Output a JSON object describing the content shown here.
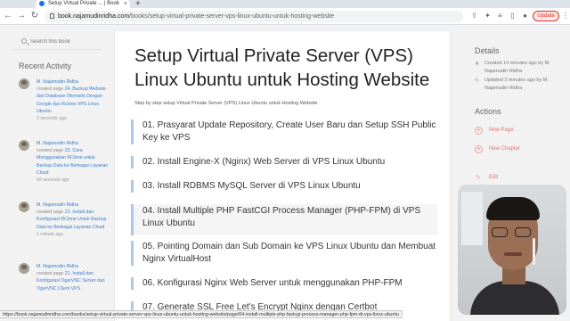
{
  "browser": {
    "tab_title": "Setup Virtual Private ... | Book",
    "new_tab_glyph": "+",
    "url_host": "book.najamudinridha.com",
    "url_path": "/books/setup-virtual-private-server-vps-linux-ubuntu-untuk-hosting-website",
    "update_label": "Update",
    "status_url": "https://book.najamudinridha.com/books/setup-virtual-private-server-vps-linux-ubuntu-untuk-hosting-website/page/04-install-multiple-php-fastcgi-process-manager-php-fpm-di-vps-linux-ubuntu"
  },
  "sidebar": {
    "search_placeholder": "Search this book",
    "recent_title": "Recent Activity",
    "activities": [
      {
        "user": "M. Najamudin Ridha",
        "action": "created page",
        "target": "24. Backup Website dan Database Otomatis Dengan Google dan Rclone VPS Linux Ubuntu",
        "time": "3 seconds ago"
      },
      {
        "user": "M. Najamudin Ridha",
        "action": "created page",
        "target": "23. Cara Menggunakan RClone untuk Backup Data ke Berbagai Layanan Cloud",
        "time": "42 seconds ago"
      },
      {
        "user": "M. Najamudin Ridha",
        "action": "created page",
        "target": "22. Install dan Konfigurasi RClone Untuk Backup Data ke Berbagai Layanan Cloud",
        "time": "1 minute ago"
      },
      {
        "user": "M. Najamudin Ridha",
        "action": "created page",
        "target": "21. Install dan Konfigurasi TigerVNC Server dan TigerVNC Client VPS",
        "time": ""
      }
    ]
  },
  "book": {
    "title": "Setup Virtual Private Server (VPS) Linux Ubuntu untuk Hosting Website",
    "description": "Step by step setup Virtual Private Server (VPS) Linux Ubuntu untuk Hosting Website",
    "chapters": [
      "01. Prasyarat Update Repository, Create User Baru dan Setup SSH Public Key ke VPS",
      "02. Install Engine-X (Nginx) Web Server di VPS Linux Ubuntu",
      "03. Install RDBMS MySQL Server di VPS Linux Ubuntu",
      "04. Install Multiple PHP FastCGI Process Manager (PHP-FPM) di VPS Linux Ubuntu",
      "05. Pointing Domain dan Sub Domain ke VPS Linux Ubuntu dan Membuat Nginx VirtualHost",
      "06. Konfigurasi Nginx Web Server untuk menggunakan PHP-FPM",
      "07. Generate SSL Free Let's Encrypt Nginx dengan Certbot"
    ]
  },
  "details": {
    "title": "Details",
    "created_text": "Created 14 minutes ago by M. Najamudin Ridha",
    "updated_text": "Updated 2 minutes ago by M. Najamudin Ridha",
    "actions_title": "Actions",
    "new_page": "New Page",
    "new_chapter": "New Chapter",
    "edit": "Edit"
  },
  "colors": {
    "chapter_border": "#a9c8ea",
    "link": "#3a7dc9",
    "action": "#e57373"
  }
}
